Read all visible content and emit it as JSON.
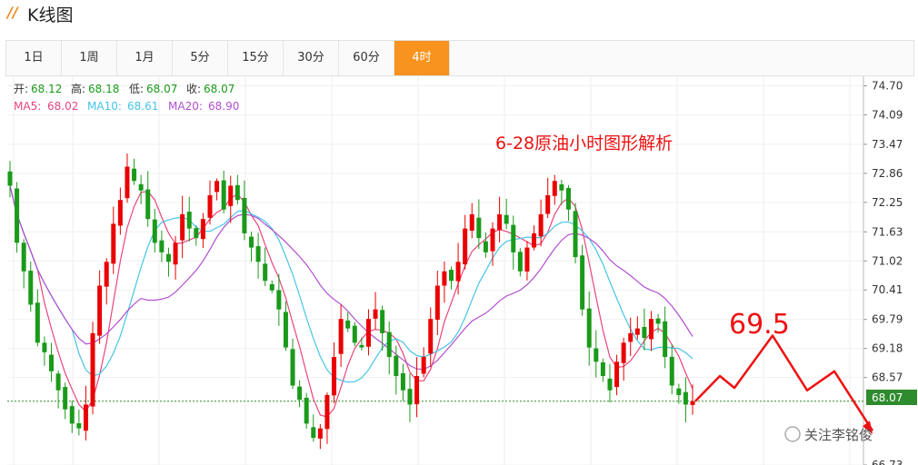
{
  "header": {
    "logo_glyph": "//",
    "title": "K线图"
  },
  "tabs": [
    {
      "label": "1日"
    },
    {
      "label": "1周"
    },
    {
      "label": "1月"
    },
    {
      "label": "5分"
    },
    {
      "label": "15分"
    },
    {
      "label": "30分"
    },
    {
      "label": "60分"
    },
    {
      "label": "4时"
    }
  ],
  "active_tab": 7,
  "info": {
    "open_label": "开:",
    "open": "68.12",
    "high_label": "高:",
    "high": "68.18",
    "low_label": "低:",
    "low": "68.07",
    "close_label": "收:",
    "close": "68.07",
    "ma5_label": "MA5:",
    "ma5": "68.02",
    "ma10_label": "MA10:",
    "ma10": "68.61",
    "ma20_label": "MA20:",
    "ma20": "68.90"
  },
  "watermark": "关注李铭俊",
  "colors": {
    "up": "#ea0000",
    "down": "#1a9a1a",
    "ma5": "#e9457a",
    "ma10": "#47c4e6",
    "ma20": "#b24fd0",
    "annotation": "#ee1111",
    "accent": "#f7931e"
  },
  "chart_data": {
    "type": "candlestick",
    "title": "6-28原油小时图形解析",
    "ylim": [
      66.73,
      74.9
    ],
    "y_ticks": [
      "74.70",
      "74.09",
      "73.47",
      "72.86",
      "72.25",
      "71.63",
      "71.02",
      "70.41",
      "69.79",
      "69.18",
      "68.57",
      "68.07",
      "66.73"
    ],
    "current_price": "68.07",
    "closes": [
      72.6,
      71.4,
      70.8,
      70.1,
      69.3,
      69.1,
      68.7,
      68.3,
      67.9,
      67.6,
      67.5,
      68.0,
      69.5,
      70.5,
      71.0,
      71.8,
      72.3,
      73.0,
      72.7,
      72.5,
      71.9,
      71.4,
      71.2,
      71.0,
      71.4,
      72.0,
      71.7,
      71.5,
      71.9,
      72.4,
      72.7,
      72.1,
      72.6,
      72.3,
      71.6,
      71.3,
      71.0,
      70.6,
      70.4,
      70.0,
      69.2,
      68.4,
      68.1,
      67.6,
      67.3,
      67.5,
      68.2,
      69.0,
      69.8,
      69.6,
      69.3,
      69.2,
      69.8,
      70.0,
      69.5,
      69.0,
      68.6,
      68.3,
      68.0,
      68.6,
      69.0,
      69.8,
      70.5,
      70.8,
      70.6,
      71.0,
      71.7,
      72.0,
      71.5,
      71.2,
      71.7,
      72.0,
      71.8,
      71.2,
      70.8,
      71.3,
      71.6,
      72.0,
      72.4,
      72.7,
      72.5,
      72.1,
      71.1,
      70.0,
      69.2,
      68.9,
      68.6,
      68.3,
      68.9,
      69.3,
      69.5,
      69.6,
      69.4,
      69.8,
      69.7,
      69.0,
      68.4,
      68.2,
      68.0,
      68.07
    ],
    "ma_series": [
      {
        "name": "MA5"
      },
      {
        "name": "MA10"
      },
      {
        "name": "MA20"
      }
    ],
    "annotation_label": "69.5",
    "projection_path": [
      68.07,
      68.6,
      68.35,
      69.45,
      68.3,
      68.7,
      67.45
    ]
  }
}
